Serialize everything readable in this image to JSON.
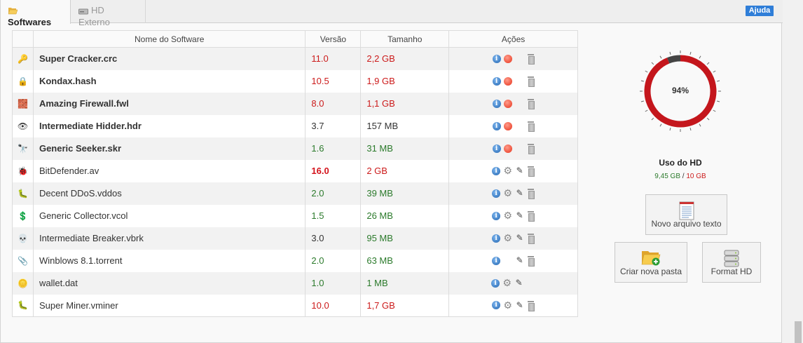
{
  "tabs": [
    {
      "label": "Softwares",
      "active": true,
      "icon": "folder-open-icon"
    },
    {
      "label": "HD Externo",
      "active": false,
      "icon": "hard-drive-icon"
    }
  ],
  "help_label": "Ajuda",
  "table": {
    "headers": [
      "Nome do Software",
      "Versão",
      "Tamanho",
      "Ações"
    ],
    "rows": [
      {
        "icon": "key-icon",
        "glyph": "🔑",
        "name": "Super Cracker.crc",
        "bold": true,
        "version": "11.0",
        "version_color": "red",
        "size": "2,2 GB",
        "size_color": "red",
        "actions": [
          "info",
          "stop",
          "",
          "trash"
        ]
      },
      {
        "icon": "lock-icon",
        "glyph": "🔒",
        "name": "Kondax.hash",
        "bold": true,
        "version": "10.5",
        "version_color": "red",
        "size": "1,9 GB",
        "size_color": "red",
        "actions": [
          "info",
          "stop",
          "",
          "trash"
        ]
      },
      {
        "icon": "firewall-icon",
        "glyph": "🧱",
        "name": "Amazing Firewall.fwl",
        "bold": true,
        "version": "8.0",
        "version_color": "red",
        "size": "1,1 GB",
        "size_color": "red",
        "actions": [
          "info",
          "stop",
          "",
          "trash"
        ]
      },
      {
        "icon": "eye-icon",
        "glyph": "👁",
        "name": "Intermediate Hidder.hdr",
        "bold": true,
        "version": "3.7",
        "version_color": "dark",
        "size": "157 MB",
        "size_color": "dark",
        "actions": [
          "info",
          "stop",
          "",
          "trash"
        ]
      },
      {
        "icon": "binoculars-icon",
        "glyph": "🔭",
        "name": "Generic Seeker.skr",
        "bold": true,
        "version": "1.6",
        "version_color": "green",
        "size": "31 MB",
        "size_color": "green",
        "actions": [
          "info",
          "stop",
          "",
          "trash"
        ]
      },
      {
        "icon": "bug-icon",
        "glyph": "🐞",
        "name": "BitDefender.av",
        "bold": false,
        "version": "16.0",
        "version_color": "boldred",
        "size": "2 GB",
        "size_color": "red",
        "actions": [
          "info",
          "gear",
          "wand",
          "trash"
        ]
      },
      {
        "icon": "bug-icon",
        "glyph": "🐛",
        "name": "Decent DDoS.vddos",
        "bold": false,
        "version": "2.0",
        "version_color": "green",
        "size": "39 MB",
        "size_color": "green",
        "actions": [
          "info",
          "gear",
          "wand",
          "trash"
        ]
      },
      {
        "icon": "dollar-icon",
        "glyph": "💲",
        "name": "Generic Collector.vcol",
        "bold": false,
        "version": "1.5",
        "version_color": "green",
        "size": "26 MB",
        "size_color": "green",
        "actions": [
          "info",
          "gear",
          "wand",
          "trash"
        ]
      },
      {
        "icon": "skull-icon",
        "glyph": "💀",
        "name": "Intermediate Breaker.vbrk",
        "bold": false,
        "version": "3.0",
        "version_color": "dark",
        "size": "95 MB",
        "size_color": "green",
        "actions": [
          "info",
          "gear",
          "wand",
          "trash"
        ]
      },
      {
        "icon": "paperclip-icon",
        "glyph": "📎",
        "name": "Winblows 8.1.torrent",
        "bold": false,
        "version": "2.0",
        "version_color": "green",
        "size": "63 MB",
        "size_color": "green",
        "actions": [
          "info",
          "",
          "wand",
          "trash"
        ]
      },
      {
        "icon": "coin-icon",
        "glyph": "🪙",
        "name": "wallet.dat",
        "bold": false,
        "version": "1.0",
        "version_color": "green",
        "size": "1 MB",
        "size_color": "green",
        "actions": [
          "info",
          "gear",
          "wand",
          ""
        ]
      },
      {
        "icon": "bug-icon",
        "glyph": "🐛",
        "name": "Super Miner.vminer",
        "bold": false,
        "version": "10.0",
        "version_color": "red",
        "size": "1,7 GB",
        "size_color": "red",
        "actions": [
          "info",
          "gear",
          "wand",
          "trash"
        ]
      }
    ]
  },
  "hd": {
    "percent_label": "94%",
    "percent": 94,
    "title": "Uso do HD",
    "used": "9,45 GB",
    "separator": " / ",
    "total": "10 GB",
    "ring_color": "#c4161c",
    "ring_remaining_color": "#444444"
  },
  "buttons": {
    "new_text": "Novo arquivo texto",
    "new_folder": "Criar nova pasta",
    "format_hd": "Format HD"
  }
}
